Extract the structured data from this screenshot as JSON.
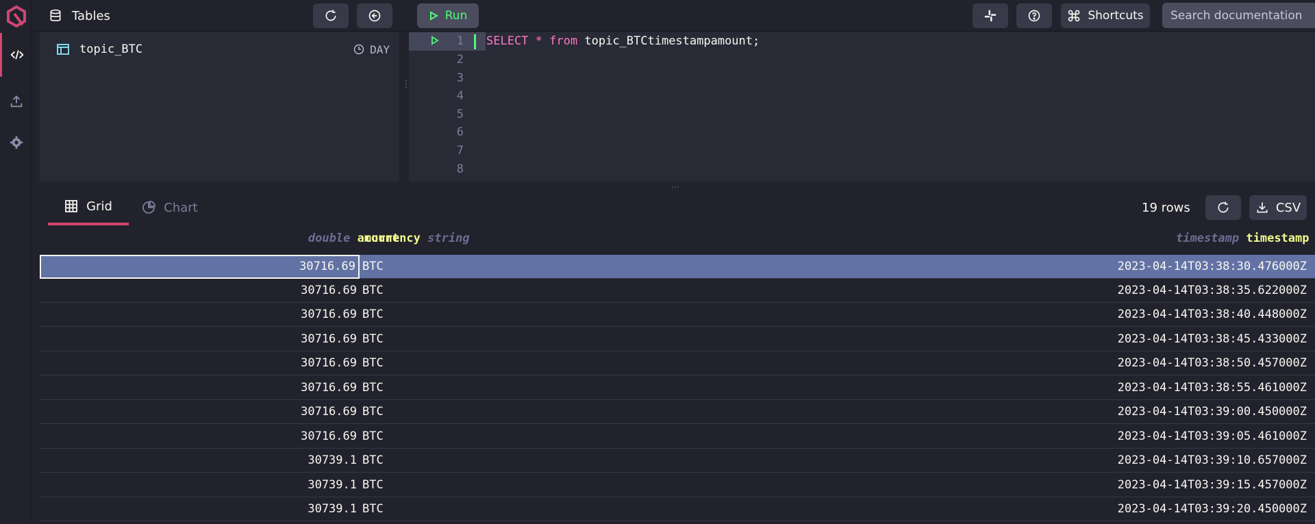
{
  "colors": {
    "accent": "#d14671",
    "run_green": "#50fa7b",
    "selection": "#6272a4",
    "type_label": "#6c6f93",
    "column_name": "#f1fa8c"
  },
  "topbar": {
    "tables_title": "Tables",
    "run_label": "Run",
    "shortcuts_label": "Shortcuts",
    "search_placeholder": "Search documentation"
  },
  "tables": {
    "items": [
      {
        "name": "topic_BTC",
        "partition": "DAY"
      }
    ]
  },
  "editor": {
    "line_numbers": [
      "1",
      "2",
      "3",
      "4",
      "5",
      "6",
      "7",
      "8"
    ],
    "code": {
      "kw_select": "SELECT",
      "star": "*",
      "kw_from": "from",
      "rest": "topic_BTCtimestampamount;"
    }
  },
  "results": {
    "tab_grid": "Grid",
    "tab_chart": "Chart",
    "rows_count": "19 rows",
    "csv_label": "CSV",
    "columns": {
      "amount": {
        "type": "double",
        "name": "amount"
      },
      "currency": {
        "name": "currency",
        "type": "string"
      },
      "timestamp": {
        "type": "timestamp",
        "name": "timestamp"
      }
    },
    "rows": [
      {
        "amount": "30716.69",
        "currency": "BTC",
        "timestamp": "2023-04-14T03:38:30.476000Z"
      },
      {
        "amount": "30716.69",
        "currency": "BTC",
        "timestamp": "2023-04-14T03:38:35.622000Z"
      },
      {
        "amount": "30716.69",
        "currency": "BTC",
        "timestamp": "2023-04-14T03:38:40.448000Z"
      },
      {
        "amount": "30716.69",
        "currency": "BTC",
        "timestamp": "2023-04-14T03:38:45.433000Z"
      },
      {
        "amount": "30716.69",
        "currency": "BTC",
        "timestamp": "2023-04-14T03:38:50.457000Z"
      },
      {
        "amount": "30716.69",
        "currency": "BTC",
        "timestamp": "2023-04-14T03:38:55.461000Z"
      },
      {
        "amount": "30716.69",
        "currency": "BTC",
        "timestamp": "2023-04-14T03:39:00.450000Z"
      },
      {
        "amount": "30716.69",
        "currency": "BTC",
        "timestamp": "2023-04-14T03:39:05.461000Z"
      },
      {
        "amount": "30739.1",
        "currency": "BTC",
        "timestamp": "2023-04-14T03:39:10.657000Z"
      },
      {
        "amount": "30739.1",
        "currency": "BTC",
        "timestamp": "2023-04-14T03:39:15.457000Z"
      },
      {
        "amount": "30739.1",
        "currency": "BTC",
        "timestamp": "2023-04-14T03:39:20.450000Z"
      }
    ]
  }
}
